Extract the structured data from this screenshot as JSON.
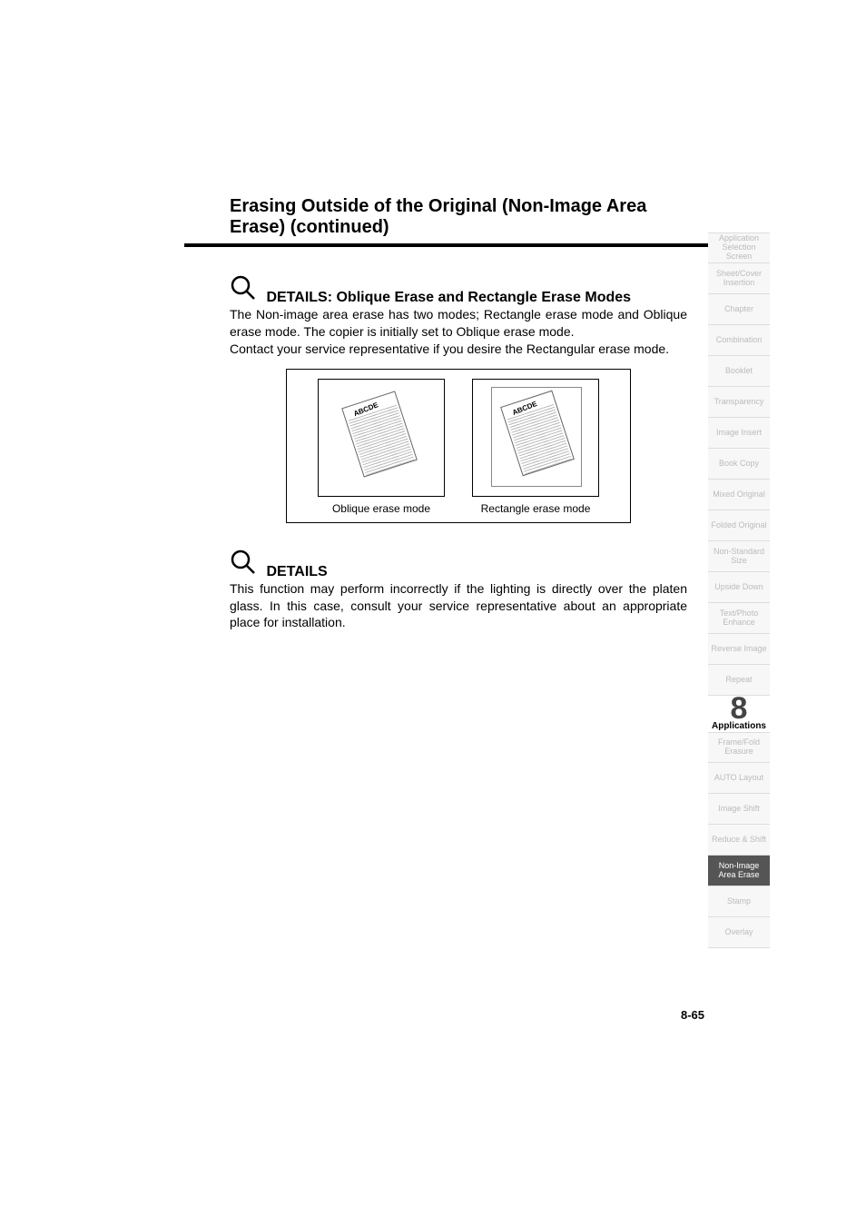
{
  "header": {
    "title": "Erasing Outside of the Original (Non-Image Area Erase) (continued)"
  },
  "details1": {
    "heading": "DETAILS: Oblique Erase and Rectangle Erase Modes",
    "p1": "The Non-image area erase has two modes; Rectangle erase mode and Oblique erase mode. The copier is initially set to Oblique erase mode.",
    "p2": "Contact your service representative if you desire the Rectangular erase mode."
  },
  "figure": {
    "doc_label": "ABCDE",
    "caption_left": "Oblique erase mode",
    "caption_right": "Rectangle erase mode"
  },
  "details2": {
    "heading": "DETAILS",
    "body": "This function may perform incorrectly if the lighting is directly over the platen glass. In this case, consult your service representative about an appropriate place for installation."
  },
  "sidebar": {
    "items": [
      "Application Selection Screen",
      "Sheet/Cover Insertion",
      "Chapter",
      "Combination",
      "Booklet",
      "Transparency",
      "Image Insert",
      "Book Copy",
      "Mixed Original",
      "Folded Original",
      "Non-Standard Size",
      "Upside Down",
      "Text/Photo Enhance",
      "Reverse Image",
      "Repeat"
    ],
    "chapter_num": "8",
    "chapter_label": "Applications",
    "items2": [
      "Frame/Fold Erasure",
      "AUTO Layout",
      "Image Shift",
      "Reduce & Shift"
    ],
    "current": "Non-Image Area Erase",
    "items3": [
      "Stamp",
      "Overlay"
    ]
  },
  "page_num": "8-65"
}
